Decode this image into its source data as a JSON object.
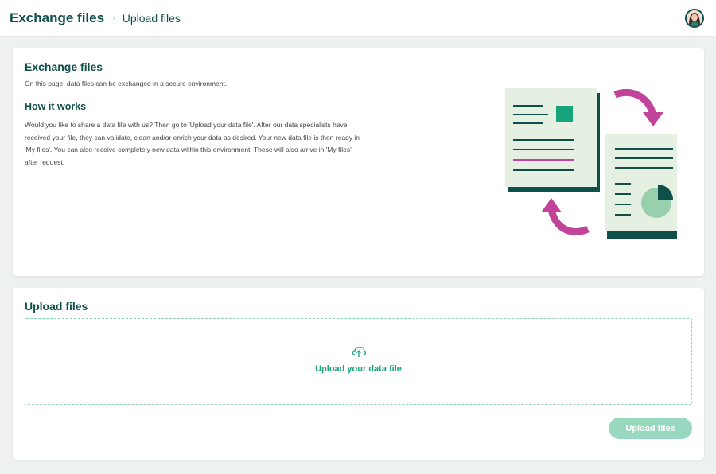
{
  "header": {
    "breadcrumb_root": "Exchange files",
    "breadcrumb_separator": "›",
    "breadcrumb_current": "Upload files",
    "avatar_icon": "user-avatar-icon"
  },
  "intro": {
    "title": "Exchange files",
    "description": "On this page, data files can be exchanged in a secure environment.",
    "how_title": "How it works",
    "how_text": "Would you like to share a data file with us? Then go to 'Upload your data file'. After our data specialists have received your file, they can validate, clean and/or enrich your data as desired. Your new data file is then ready in 'My files'. You can also receive completely new data within this environment. These will also arrive in 'My files' after request.",
    "illustration_icon": "file-exchange-illustration"
  },
  "upload": {
    "title": "Upload files",
    "dropzone_label": "Upload your data file",
    "dropzone_icon": "cloud-upload-icon",
    "button_label": "Upload files"
  },
  "colors": {
    "brand_dark": "#0f4f4a",
    "accent_green": "#17a37b",
    "button_disabled": "#98d8bf",
    "accent_pink": "#c2449a",
    "page_bg": "#edf1f1"
  }
}
